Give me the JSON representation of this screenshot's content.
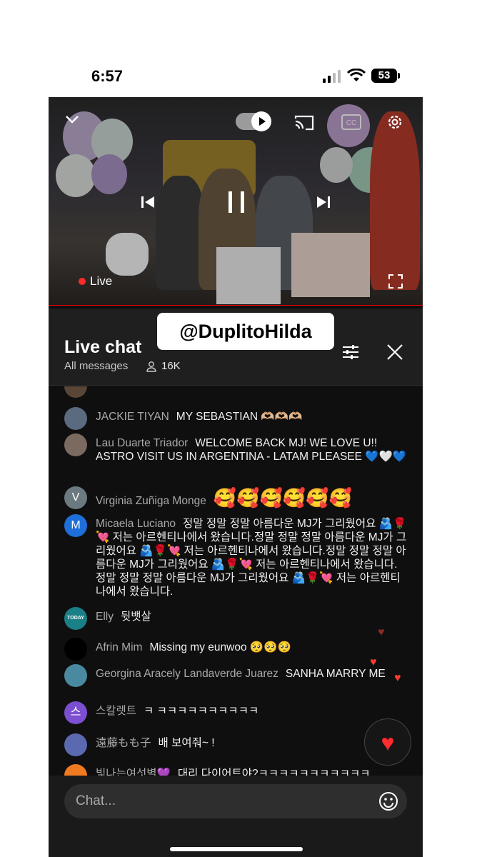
{
  "status": {
    "time": "6:57",
    "battery": "53"
  },
  "video": {
    "live_label": "Live",
    "icons": [
      "chevron-down-icon",
      "cast-icon",
      "cc-icon",
      "gear-icon",
      "prev-icon",
      "pause-icon",
      "next-icon",
      "fullscreen-icon"
    ]
  },
  "chat": {
    "title": "Live chat",
    "filter": "All messages",
    "viewers": "16K",
    "watermark": "@DuplitoHilda",
    "input_placeholder": "Chat...",
    "messages": [
      {
        "author": "JACKIE TIYAN",
        "text": "MY SEBASTIAN 🫶🏼🫶🏼🫶🏼",
        "avatar_letter": "",
        "avatar_color": "#5a6b80"
      },
      {
        "author": "Lau Duarte Triador",
        "text": "WELCOME BACK MJ! WE LOVE U!! ASTRO VISIT US IN ARGENTINA - LATAM PLEASEE 💙🤍💙",
        "avatar_letter": "",
        "avatar_color": "#7a6a60"
      },
      {
        "author": "Virginia Zuñiga Monge",
        "text": "🥰🥰🥰🥰🥰🥰",
        "avatar_letter": "V",
        "avatar_color": "#6b7a80"
      },
      {
        "author": "Micaela Luciano",
        "text": "정말 정말 정말 아름다운 MJ가 그리웠어요 🫂🌹💘 저는 아르헨티나에서 왔습니다.정말 정말 정말 아름다운 MJ가 그리웠어요 🫂🌹💘 저는 아르헨티나에서 왔습니다.정말 정말 정말 아름다운 MJ가 그리웠어요 🫂🌹💘 저는 아르헨티나에서 왔습니다.정말 정말 정말 아름다운 MJ가 그리웠어요 🫂🌹💘 저는 아르헨티나에서 왔습니다.",
        "avatar_letter": "M",
        "avatar_color": "#1e6fd9"
      },
      {
        "author": "Elly",
        "text": "뒷뱃살",
        "avatar_letter": "TODAY",
        "avatar_color": "#1a7f86"
      },
      {
        "author": "Afrin Mim",
        "text": "Missing my eunwoo 🥺🥺🥺",
        "avatar_letter": "",
        "avatar_color": "#000000"
      },
      {
        "author": "Georgina Aracely Landaverde Juarez",
        "text": "SANHA MARRY ME",
        "avatar_letter": "",
        "avatar_color": "#4a8aa0"
      },
      {
        "author": "스칼렛트",
        "text": "ㅋ ㅋㅋㅋㅋㅋㅋㅋㅋㅋㅋ",
        "avatar_letter": "스",
        "avatar_color": "#7b4fd0"
      },
      {
        "author": "遠藤もも子",
        "text": "배 보여줘~ !",
        "avatar_letter": "",
        "avatar_color": "#5b6ab0"
      },
      {
        "author": "빛나는여섯별💜",
        "text": "대리 다이어트야?ㅋㅋㅋㅋㅋㅋㅋㅋㅋㅋㅋ",
        "avatar_letter": "",
        "avatar_color": "#f07a20"
      }
    ]
  }
}
